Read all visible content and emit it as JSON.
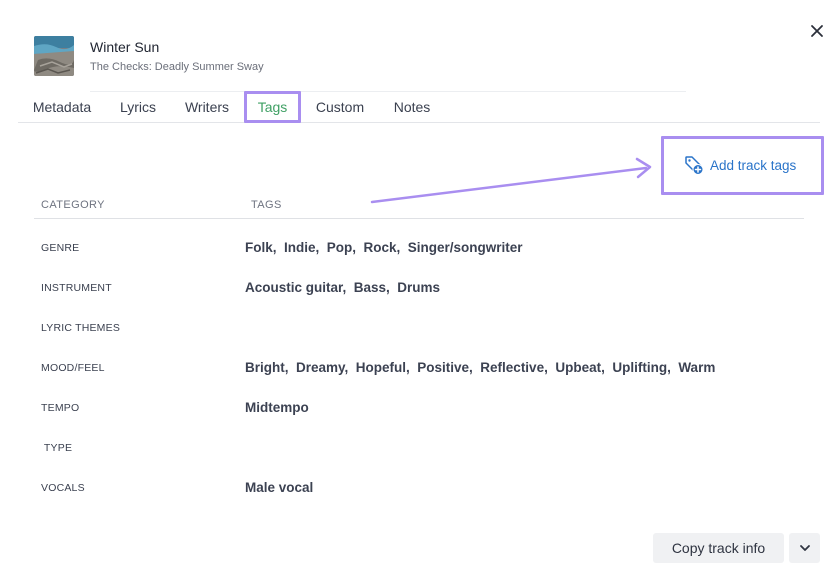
{
  "track": {
    "title": "Winter Sun",
    "subtitle": "The Checks: Deadly Summer Sway"
  },
  "tabs": [
    {
      "label": "Metadata",
      "active": false
    },
    {
      "label": "Lyrics",
      "active": false
    },
    {
      "label": "Writers",
      "active": false
    },
    {
      "label": "Tags",
      "active": true
    },
    {
      "label": "Custom",
      "active": false
    },
    {
      "label": "Notes",
      "active": false
    }
  ],
  "actions": {
    "add_tags_label": "Add track tags",
    "copy_label": "Copy track info"
  },
  "table": {
    "headers": {
      "category": "CATEGORY",
      "tags": "TAGS"
    },
    "rows": [
      {
        "category": "GENRE",
        "tags": "Folk,  Indie,  Pop,  Rock,  Singer/songwriter"
      },
      {
        "category": "INSTRUMENT",
        "tags": "Acoustic guitar,  Bass,  Drums"
      },
      {
        "category": "LYRIC THEMES",
        "tags": ""
      },
      {
        "category": "MOOD/FEEL",
        "tags": "Bright,  Dreamy,  Hopeful,  Positive,  Reflective,  Upbeat,  Uplifting,  Warm"
      },
      {
        "category": "TEMPO",
        "tags": "Midtempo"
      },
      {
        "category": " TYPE",
        "tags": ""
      },
      {
        "category": "VOCALS",
        "tags": "Male vocal"
      }
    ]
  },
  "colors": {
    "active_tab": "#3fa064",
    "link": "#2a74c9",
    "highlight": "#a98ef0",
    "button_bg": "#f0f1f3"
  },
  "icons": {
    "close": "close-icon",
    "add_tag": "tag-plus-icon",
    "dropdown": "chevron-down-icon"
  }
}
